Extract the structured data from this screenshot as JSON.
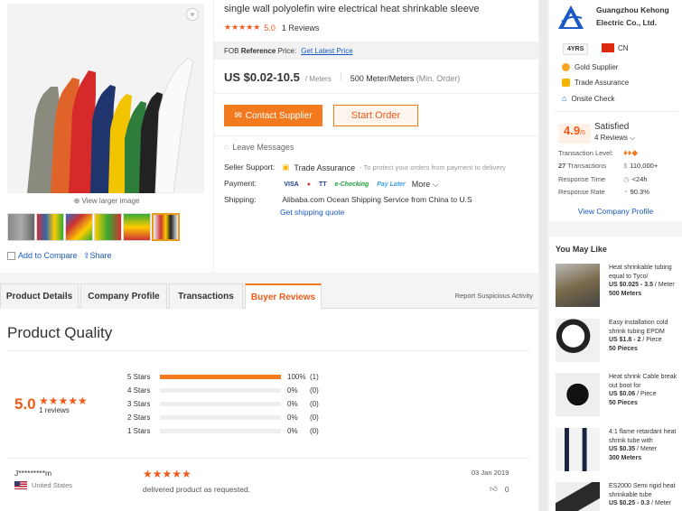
{
  "product": {
    "title": "single wall polyolefin wire electrical heat shrinkable sleeve",
    "stars": "★★★★★",
    "rating": "5.0",
    "reviews_count": "1 Reviews",
    "fob_label": "FOB",
    "fob_ref": "Reference",
    "fob_price_label": "Price:",
    "fob_link": "Get Latest Price",
    "price": "US $0.02-10.5",
    "price_unit": "/ Meters",
    "moq": "500 Meter/Meters",
    "moq_note": "(Min. Order)",
    "contact_label": "Contact Supplier",
    "order_label": "Start Order",
    "leave_messages": "Leave Messages",
    "seller_support_label": "Seller Support:",
    "trade_assurance": "Trade Assurance",
    "protect_note": "- To protect your orders from payment to delivery",
    "payment_label": "Payment:",
    "payment_methods": [
      "VISA",
      "MC",
      "TT",
      "e-Checking",
      "Pay Later"
    ],
    "more_label": "More",
    "shipping_label": "Shipping:",
    "shipping_value": "Alibaba.com Ocean Shipping Service from China to U.S",
    "shipping_quote": "Get shipping quote"
  },
  "gallery": {
    "view_larger": "View larger image",
    "add_compare": "Add to Compare",
    "share": "Share"
  },
  "supplier": {
    "name": "Guangzhou Kehong Electric Co., Ltd.",
    "years": "4YRS",
    "country": "CN",
    "badges": [
      "Gold Supplier",
      "Trade Assurance",
      "Onsite Check"
    ],
    "score": "4.9",
    "score_of": "/5",
    "satisfaction": "Satisfied",
    "sat_reviews": "4 Reviews",
    "metrics": {
      "level_label": "Transaction Level:",
      "transactions_value": "27",
      "transactions_label": "Transactions",
      "transactions_amount": "110,000+",
      "response_time_label": "Response Time",
      "response_time_value": "<24h",
      "response_rate_label": "Response Rate",
      "response_rate_value": "90.3%"
    },
    "view_profile": "View Company Profile",
    "colors": {
      "brand_blue": "#1a59c4",
      "accent": "#f37a1f"
    }
  },
  "you_may_like": {
    "title": "You May Like",
    "items": [
      {
        "desc": "Heat shrinkable tubing equal to Tyco/",
        "price": "US $0.025 - 3.5",
        "unit": "/ Meter",
        "moq": "500 Meters"
      },
      {
        "desc": "Easy installation cold shrink tubing EPDM",
        "price": "US $1.8 - 2",
        "unit": "/ Piece",
        "moq": "50 Pieces"
      },
      {
        "desc": "Heat shrink Cable break out boot for",
        "price": "US $0.06",
        "unit": "/ Piece",
        "moq": "50 Pieces"
      },
      {
        "desc": "4:1 flame retardant heat shrink tube with",
        "price": "US $0.35",
        "unit": "/ Meter",
        "moq": "300 Meters"
      },
      {
        "desc": "ES2000 Semi rigid heat shrinkable tube",
        "price": "US $0.25 - 0.3",
        "unit": "/ Meter",
        "moq": ""
      }
    ]
  },
  "tabs": {
    "items": [
      "Product Details",
      "Company Profile",
      "Transactions",
      "Buyer Reviews"
    ],
    "active": "Buyer Reviews",
    "report": "Report Suspicious Activity"
  },
  "reviews": {
    "section_title": "Product Quality",
    "score": "5.0",
    "stars": "★★★★★",
    "count": "1 reviews",
    "distribution": [
      {
        "label": "5 Stars",
        "fraction": 1.0,
        "pct": "100%",
        "count": "(1)"
      },
      {
        "label": "4 Stars",
        "fraction": 0,
        "pct": "0%",
        "count": "(0)"
      },
      {
        "label": "3 Stars",
        "fraction": 0,
        "pct": "0%",
        "count": "(0)"
      },
      {
        "label": "2 Stars",
        "fraction": 0,
        "pct": "0%",
        "count": "(0)"
      },
      {
        "label": "1 Stars",
        "fraction": 0,
        "pct": "0%",
        "count": "(0)"
      }
    ],
    "entry": {
      "reviewer": "J*********m",
      "country": "United States",
      "stars": "★★★★★",
      "text": "delivered product as requested.",
      "date": "03 Jan 2019",
      "likes": "0"
    }
  }
}
